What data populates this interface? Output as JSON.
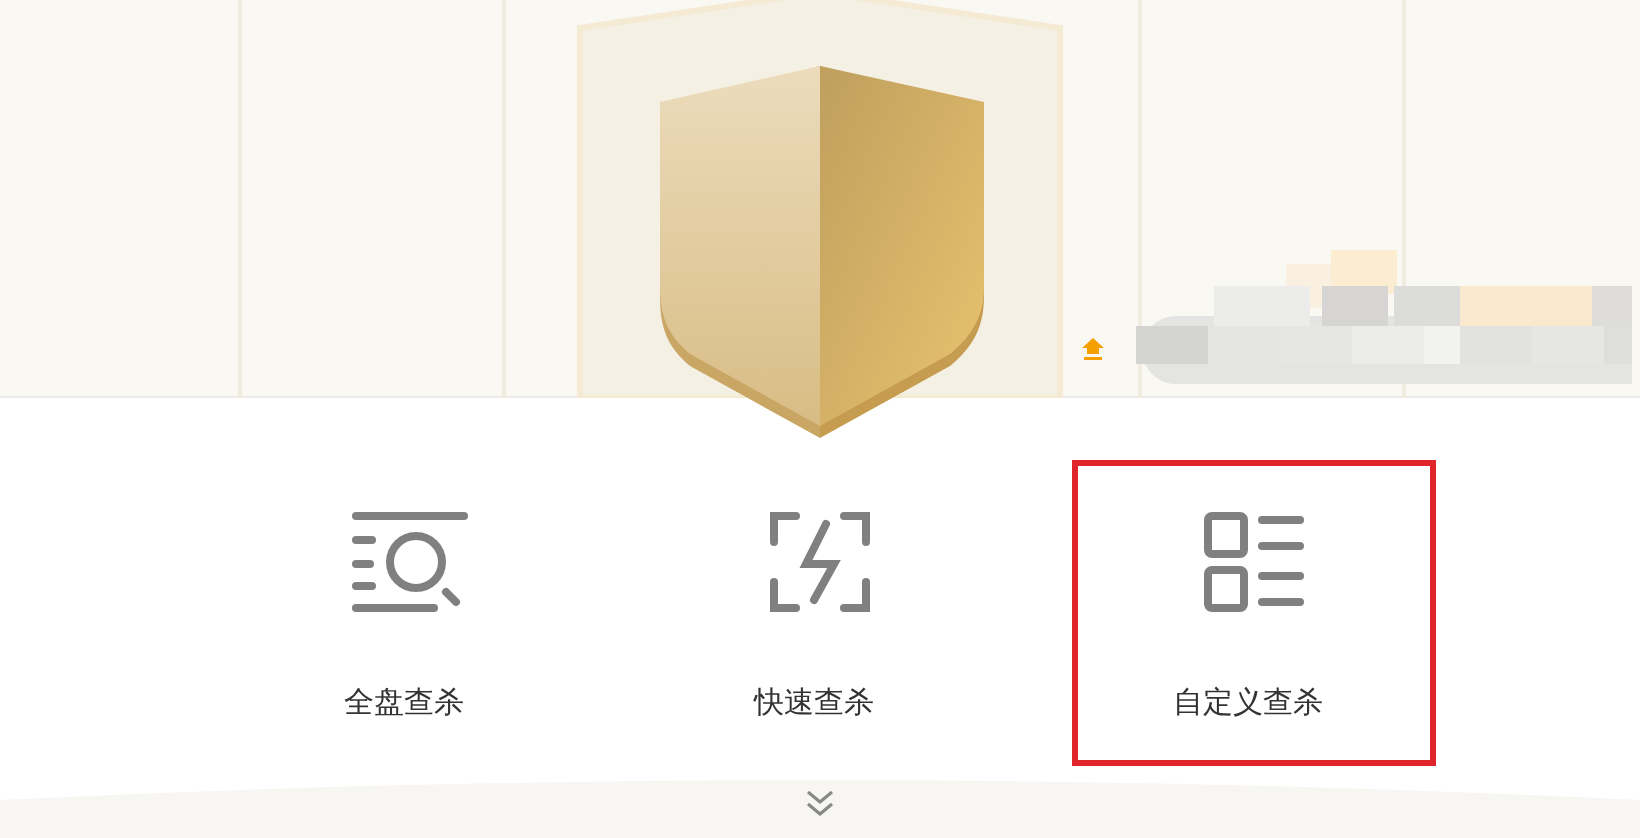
{
  "scan_options": [
    {
      "kind": "full",
      "label": "全盘查杀",
      "selected": false
    },
    {
      "kind": "quick",
      "label": "快速查杀",
      "selected": false
    },
    {
      "kind": "custom",
      "label": "自定义查杀",
      "selected": true
    }
  ]
}
